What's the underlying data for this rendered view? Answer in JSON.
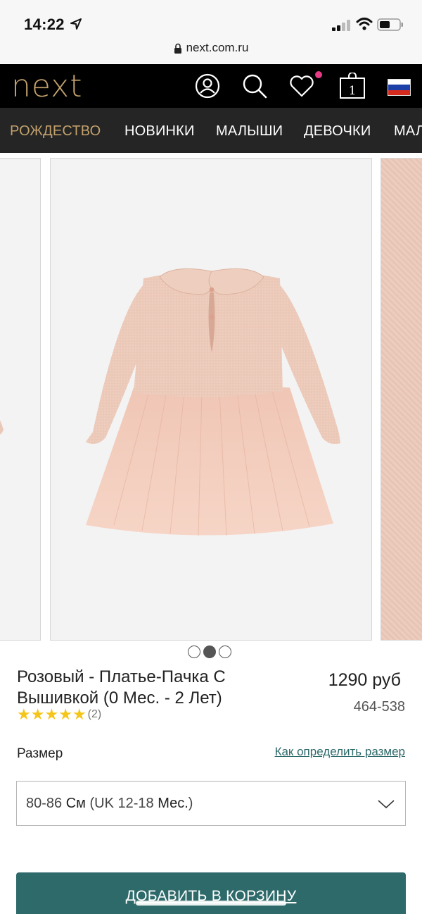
{
  "status_bar": {
    "time": "14:22"
  },
  "browser": {
    "url": "next.com.ru"
  },
  "header": {
    "logo": "next",
    "bag_count": "1",
    "icons": [
      "account-icon",
      "search-icon",
      "wishlist-icon",
      "bag-icon",
      "flag-icon"
    ],
    "colors": {
      "background": "#000000",
      "logo": "#c2a16b",
      "wishlist_dot": "#e73b86"
    }
  },
  "nav": {
    "items": [
      {
        "label": "РОЖДЕСТВО",
        "active": true
      },
      {
        "label": "НОВИНКИ"
      },
      {
        "label": "МАЛЫШИ"
      },
      {
        "label": "ДЕВОЧКИ"
      },
      {
        "label": "МАЛ"
      }
    ]
  },
  "gallery": {
    "slide_count": 3,
    "active_index": 1
  },
  "product": {
    "title_line1": "Розовый - Платье-Пачка С",
    "title_line2": "Вышивкой (0 Мес. - 2 Лет)",
    "price": "1290 руб",
    "sku": "464-538",
    "rating_stars": 5,
    "rating_count": "(2)"
  },
  "size": {
    "label": "Размер",
    "guide_link": "Как определить размер",
    "selected_part1": "80-86 ",
    "selected_unit1": "См",
    "selected_part2": " (UK 12-18 ",
    "selected_unit2": "Мес.",
    "selected_part3": ")"
  },
  "actions": {
    "add_to_bag": "ДОБАВИТЬ В КОРЗИНУ",
    "accent": "#2f6a6b"
  }
}
